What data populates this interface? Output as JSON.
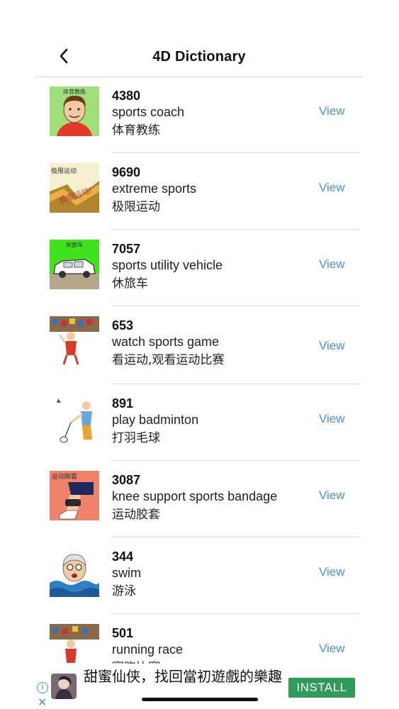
{
  "header": {
    "title": "4D Dictionary",
    "back_icon": "chevron-left-icon"
  },
  "entries": [
    {
      "number": "4380",
      "english": "sports coach",
      "chinese": "体育教练",
      "action": "View",
      "image": "sports-coach-illustration",
      "image_caption": "体育教练"
    },
    {
      "number": "9690",
      "english": "extreme sports",
      "chinese": "极限运动",
      "action": "View",
      "image": "extreme-sports-illustration",
      "image_caption": "极限运动"
    },
    {
      "number": "7057",
      "english": "sports utility vehicle",
      "chinese": "休旅车",
      "action": "View",
      "image": "suv-illustration",
      "image_caption": "休旅车"
    },
    {
      "number": "653",
      "english": "watch sports game",
      "chinese": "看运动,观看运动比赛",
      "action": "View",
      "image": "watch-sports-illustration",
      "image_caption": ""
    },
    {
      "number": "891",
      "english": "play badminton",
      "chinese": "打羽毛球",
      "action": "View",
      "image": "badminton-illustration",
      "image_caption": ""
    },
    {
      "number": "3087",
      "english": "knee support sports bandage",
      "chinese": "运动胶套",
      "action": "View",
      "image": "knee-support-illustration",
      "image_caption": "运动脚套"
    },
    {
      "number": "344",
      "english": "swim",
      "chinese": "游泳",
      "action": "View",
      "image": "swimmer-illustration",
      "image_caption": ""
    },
    {
      "number": "501",
      "english": "running race",
      "chinese": "赛跑比赛",
      "action": "View",
      "image": "running-race-illustration",
      "image_caption": ""
    }
  ],
  "ad": {
    "text": "甜蜜仙侠，找回當初遊戲的樂趣",
    "button": "INSTALL",
    "info_icon": "info-icon",
    "close_icon": "close-icon",
    "info_glyph": "i",
    "close_glyph": "✕"
  },
  "colors": {
    "link": "#4a8fd8",
    "install": "#2f9a5a",
    "divider": "#dcdcdc"
  }
}
